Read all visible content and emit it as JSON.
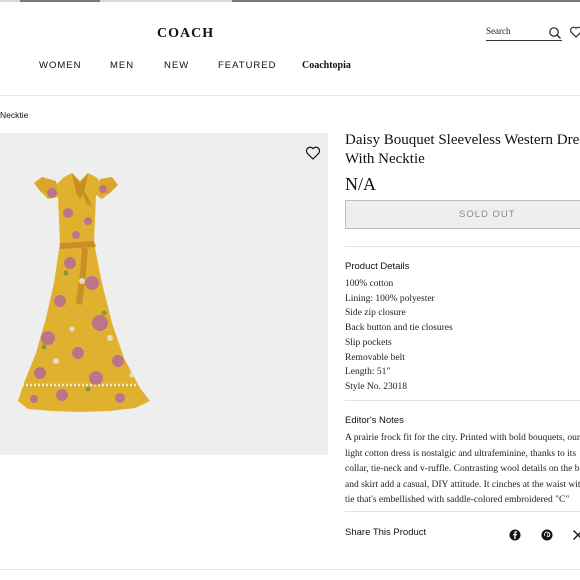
{
  "brand": {
    "logo": "COACH"
  },
  "search": {
    "placeholder": "Search"
  },
  "nav": {
    "items": [
      "WOMEN",
      "MEN",
      "NEW",
      "FEATURED",
      "Coachtopia"
    ]
  },
  "breadcrumb": {
    "current": "Necktie"
  },
  "product": {
    "title_line1": "Daisy Bouquet Sleeveless Western Dress",
    "title_line2": "With Necktie",
    "price": "N/A",
    "button_label": "SOLD OUT",
    "image_colors": {
      "background": "#eeeeee",
      "dress": "#e0b12e",
      "flowers": "#b86a9a"
    }
  },
  "details": {
    "heading": "Product Details",
    "items": [
      "100% cotton",
      "Lining: 100% polyester",
      "Side zip closure",
      "Back button and tie closures",
      "Slip pockets",
      "Removable belt",
      "Length: 51\"",
      "Style No. 23018"
    ]
  },
  "notes": {
    "heading": "Editor's Notes",
    "lines": [
      "A prairie frock fit for the city. Printed with bold bouquets, our",
      "light cotton dress is nostalgic and ultrafeminine, thanks to its",
      "collar, tie-neck and v-ruffle. Contrasting wool details on the bodice",
      "and skirt add a casual, DIY attitude. It cinches at the waist with a",
      "tie that's embellished with saddle-colored embroidered \"C\""
    ]
  },
  "share": {
    "label": "Share This Product",
    "icons": [
      "facebook-icon",
      "pinterest-icon",
      "x-icon"
    ]
  }
}
